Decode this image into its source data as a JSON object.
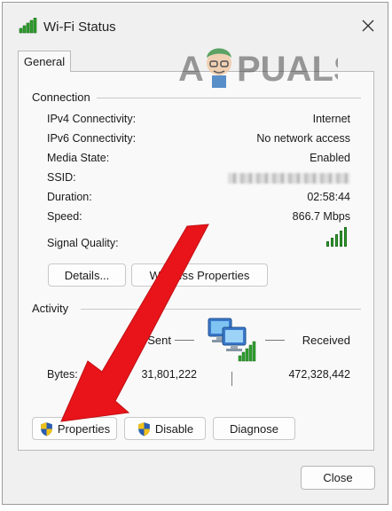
{
  "window": {
    "title": "Wi-Fi Status"
  },
  "tabs": [
    {
      "label": "General"
    }
  ],
  "connection": {
    "section_title": "Connection",
    "rows": [
      {
        "label": "IPv4 Connectivity:",
        "value": "Internet"
      },
      {
        "label": "IPv6 Connectivity:",
        "value": "No network access"
      },
      {
        "label": "Media State:",
        "value": "Enabled"
      },
      {
        "label": "SSID:",
        "value": ""
      },
      {
        "label": "Duration:",
        "value": "02:58:44"
      },
      {
        "label": "Speed:",
        "value": "866.7 Mbps"
      }
    ],
    "signal_label": "Signal Quality:",
    "signal_level": "5 of 5",
    "details_button": "Details...",
    "wireless_button": "Wireless Properties"
  },
  "activity": {
    "section_title": "Activity",
    "sent_label": "Sent",
    "received_label": "Received",
    "bytes_label": "Bytes:",
    "bytes_sent": "31,801,222",
    "bytes_received": "472,328,442"
  },
  "buttons": {
    "properties": "Properties",
    "disable": "Disable",
    "diagnose": "Diagnose",
    "close": "Close"
  },
  "watermark": {
    "text": "APPUALS"
  },
  "colors": {
    "signal": "#2e9e2e",
    "arrow": "#e8141a",
    "shield_blue": "#2a5db0",
    "shield_yellow": "#f2c21a"
  },
  "icons": {
    "title": "wifi-signal-icon",
    "close": "close-icon",
    "network": "network-computers-icon",
    "shield": "uac-shield-icon"
  }
}
